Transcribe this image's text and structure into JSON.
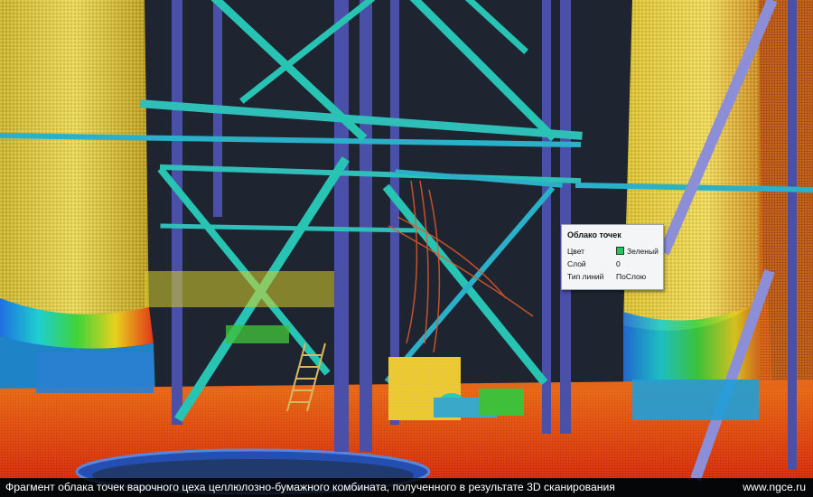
{
  "tooltip": {
    "title": "Облако точек",
    "rows": [
      {
        "key": "Цвет",
        "value": "Зеленый",
        "swatch": "#22c55e"
      },
      {
        "key": "Слой",
        "value": "0"
      },
      {
        "key": "Тип линий",
        "value": "ПоСлою"
      }
    ]
  },
  "caption": {
    "text": "Фрагмент облака точек варочного цеха целлюлозно-бумажного комбината, полученного в результате 3D сканирования",
    "site": "www.ngce.ru"
  },
  "colors": {
    "background": "#1e2531",
    "structure_blue": "#4a4fa8",
    "structure_cyan": "#2fbfb8",
    "cloud_yellow": "#d8c23a",
    "cloud_red": "#e0321a",
    "cloud_green": "#3fbf3a"
  }
}
